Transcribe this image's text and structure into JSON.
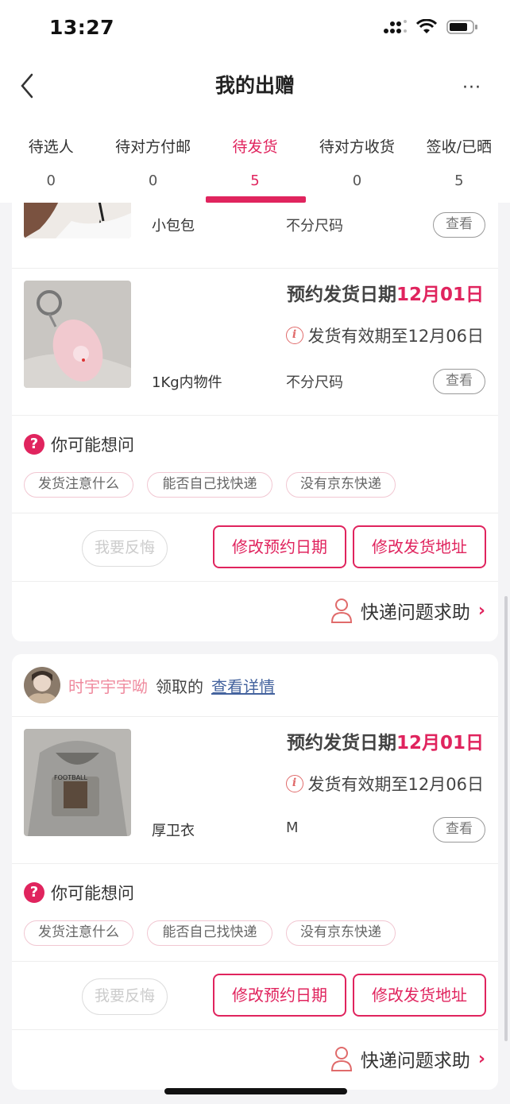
{
  "status_bar": {
    "time": "13:27"
  },
  "nav": {
    "title": "我的出赠",
    "more": "···"
  },
  "tabs": [
    {
      "label": "待选人",
      "count": "0"
    },
    {
      "label": "待对方付邮",
      "count": "0"
    },
    {
      "label": "待发货",
      "count": "5"
    },
    {
      "label": "待对方收货",
      "count": "0"
    },
    {
      "label": "签收/已晒",
      "count": "5"
    }
  ],
  "card1": {
    "item0": {
      "name": "小包包",
      "size": "不分尺码",
      "view": "查看"
    },
    "item1": {
      "ship_label": "预约发货日期",
      "ship_date": "12月01日",
      "valid": "发货有效期至12月06日",
      "name": "1Kg内物件",
      "size": "不分尺码",
      "view": "查看"
    },
    "faq_title": "你可能想问",
    "faq_chips": [
      "发货注意什么",
      "能否自己找快递",
      "没有京东快递"
    ],
    "regret": "我要反悔",
    "btn_modify_date": "修改预约日期",
    "btn_modify_addr": "修改发货地址",
    "help": "快递问题求助"
  },
  "card2": {
    "giver_name": "时宇宇宇呦",
    "giver_action": "领取的",
    "view_details": "查看详情",
    "item": {
      "ship_label": "预约发货日期",
      "ship_date": "12月01日",
      "valid": "发货有效期至12月06日",
      "name": "厚卫衣",
      "size": "M",
      "view": "查看"
    },
    "faq_title": "你可能想问",
    "faq_chips": [
      "发货注意什么",
      "能否自己找快递",
      "没有京东快递"
    ],
    "regret": "我要反悔",
    "btn_modify_date": "修改预约日期",
    "btn_modify_addr": "修改发货地址",
    "help": "快递问题求助"
  },
  "colors": {
    "accent": "#e0245e"
  }
}
